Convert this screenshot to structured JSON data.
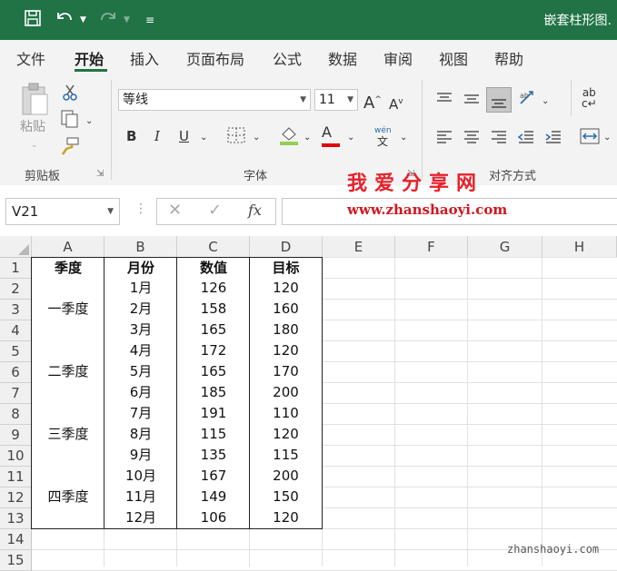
{
  "window": {
    "title": "嵌套柱形图."
  },
  "menu": {
    "items": [
      "文件",
      "开始",
      "插入",
      "页面布局",
      "公式",
      "数据",
      "审阅",
      "视图",
      "帮助"
    ],
    "active": "开始"
  },
  "ribbon": {
    "clipboard": {
      "label": "剪贴板",
      "paste": "粘贴"
    },
    "font": {
      "label": "字体",
      "name": "等线",
      "size": "11",
      "bold": "B",
      "italic": "I",
      "underline": "U",
      "phonetic_top": "wén",
      "phonetic_bottom": "文"
    },
    "alignment": {
      "label": "对齐方式"
    }
  },
  "formula_bar": {
    "name_box": "V21",
    "fx": "fx"
  },
  "watermark": {
    "line1": "我爱分享网",
    "line2": "www.zhanshaoyi.com",
    "corner": "zhanshaoyi.com"
  },
  "sheet": {
    "columns": [
      "A",
      "B",
      "C",
      "D",
      "E",
      "F",
      "G",
      "H"
    ],
    "rows": [
      "1",
      "2",
      "3",
      "4",
      "5",
      "6",
      "7",
      "8",
      "9",
      "10",
      "11",
      "12",
      "13",
      "14",
      "15"
    ],
    "headers": [
      "季度",
      "月份",
      "数值",
      "目标"
    ],
    "quarters": [
      "一季度",
      "二季度",
      "三季度",
      "四季度"
    ],
    "data": [
      [
        "1月",
        "126",
        "120"
      ],
      [
        "2月",
        "158",
        "160"
      ],
      [
        "3月",
        "165",
        "180"
      ],
      [
        "4月",
        "172",
        "120"
      ],
      [
        "5月",
        "165",
        "170"
      ],
      [
        "6月",
        "185",
        "200"
      ],
      [
        "7月",
        "191",
        "110"
      ],
      [
        "8月",
        "115",
        "120"
      ],
      [
        "9月",
        "135",
        "115"
      ],
      [
        "10月",
        "167",
        "200"
      ],
      [
        "11月",
        "149",
        "150"
      ],
      [
        "12月",
        "106",
        "120"
      ]
    ]
  }
}
